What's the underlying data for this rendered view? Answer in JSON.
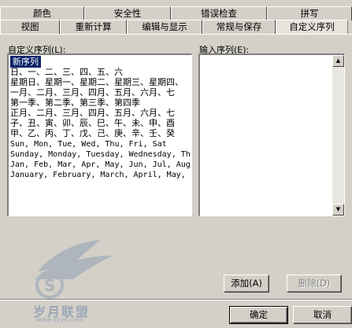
{
  "tabs_row1": [
    "颜色",
    "安全性",
    "错误检查",
    "拼写"
  ],
  "tabs_row2": [
    "视图",
    "重新计算",
    "编辑与显示",
    "常规与保存",
    "自定义序列"
  ],
  "left_label": "自定义序列(L):",
  "right_label": "输入序列(E):",
  "custom_lists": [
    "新序列",
    "日、一、二、三、四、五、六",
    "星期日、星期一、星期二、星期三、星期四、",
    "一月、二月、三月、四月、五月、六月、七",
    "第一季、第二季、第三季、第四季",
    "正月、二月、三月、四月、五月、六月、七",
    "子、丑、寅、卯、辰、巳、午、未、申、酉",
    "甲、乙、丙、丁、戊、己、庚、辛、壬、癸",
    "Sun, Mon, Tue, Wed, Thu, Fri, Sat",
    "Sunday, Monday, Tuesday, Wednesday, Th",
    "Jan, Feb, Mar, Apr, May, Jun, Jul, Aug",
    "January, February, March, April, May, ."
  ],
  "selected_index": 0,
  "input_value": "",
  "buttons": {
    "add": "添加(A)",
    "delete": "删除(D)",
    "ok": "确定",
    "cancel": "取消"
  },
  "watermark": {
    "text": "岁月联盟",
    "url_text": "www.syue.com"
  }
}
